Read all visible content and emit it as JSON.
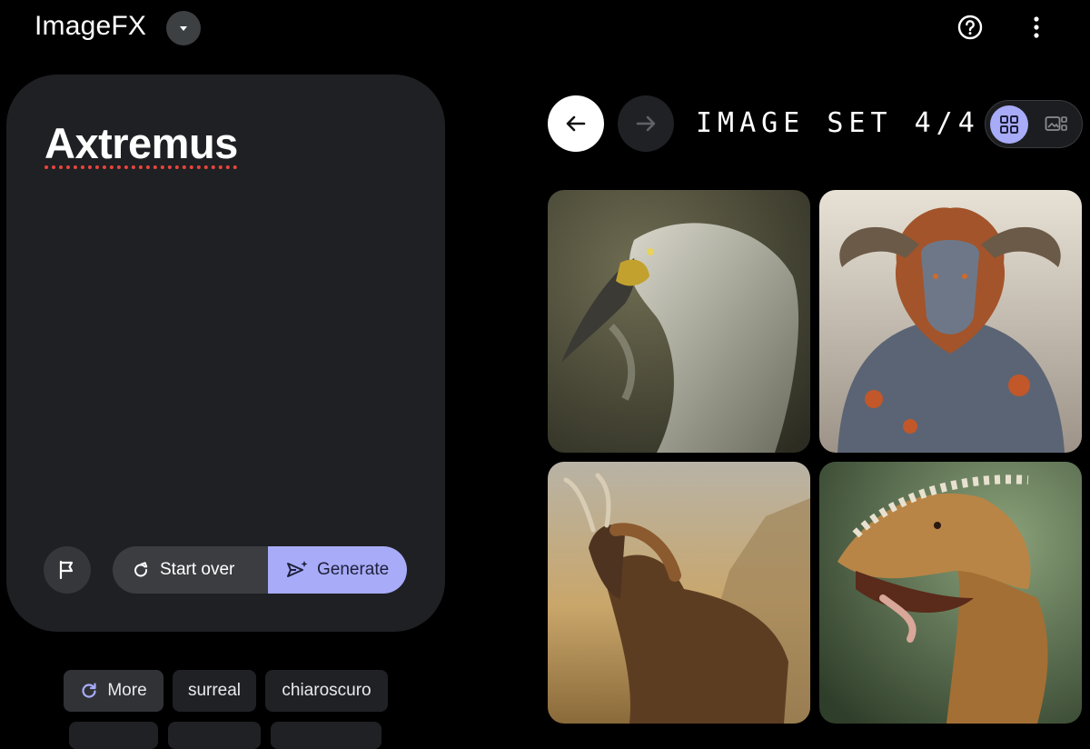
{
  "header": {
    "title": "ImageFX",
    "dropdown_icon": "caret-down-icon",
    "help_icon": "help-circle-icon",
    "more_icon": "more-vert-icon"
  },
  "prompt": {
    "text": "Axtremus",
    "flag_icon": "flag-icon",
    "start_over_label": "Start over",
    "generate_label": "Generate"
  },
  "chips": [
    {
      "label": "More",
      "icon": "refresh-icon"
    },
    {
      "label": "surreal"
    },
    {
      "label": "chiaroscuro"
    }
  ],
  "gallery": {
    "set_label": "IMAGE SET 4/4",
    "images": [
      {
        "subject": "dodo-like feathered reptile bird portrait"
      },
      {
        "subject": "horned ram-headed beast with orange mane"
      },
      {
        "subject": "horse-bodied creature with curved horns in rocky landscape"
      },
      {
        "subject": "spiked dragon head with open jaws"
      }
    ]
  },
  "colors": {
    "accent": "#a8abf8",
    "card": "#1f2023",
    "background": "#000000"
  }
}
